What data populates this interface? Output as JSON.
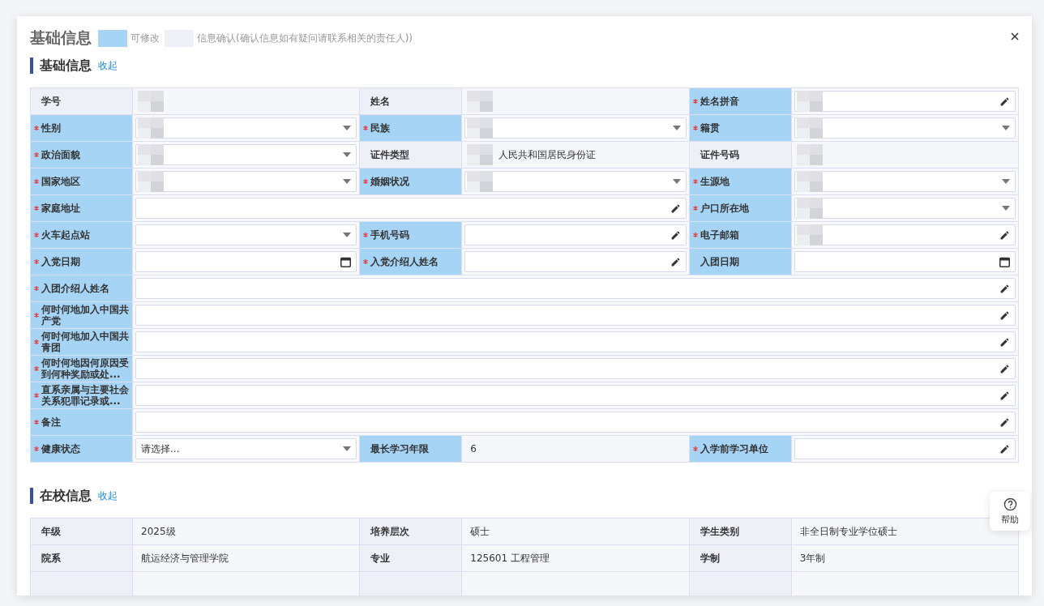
{
  "dialog": {
    "title": "基础信息",
    "legend": [
      {
        "kind": "editable",
        "label": "可修改"
      },
      {
        "kind": "confirm",
        "label": "信息确认(确认信息如有疑问请联系相关的责任人))"
      }
    ]
  },
  "sections": [
    {
      "title": "基础信息",
      "toggle": "收起",
      "fields": [
        {
          "label": "学号",
          "required": false,
          "editable": false,
          "kind": "readonly",
          "redacted": true
        },
        {
          "label": "姓名",
          "required": false,
          "editable": false,
          "kind": "readonly",
          "redacted": true
        },
        {
          "label": "姓名拼音",
          "required": true,
          "editable": true,
          "kind": "text",
          "redacted": true
        },
        {
          "label": "性别",
          "required": true,
          "editable": true,
          "kind": "select",
          "redacted": true
        },
        {
          "label": "民族",
          "required": true,
          "editable": true,
          "kind": "select",
          "redacted": true
        },
        {
          "label": "籍贯",
          "required": true,
          "editable": true,
          "kind": "select",
          "redacted": true
        },
        {
          "label": "政治面貌",
          "required": true,
          "editable": true,
          "kind": "select",
          "redacted": true
        },
        {
          "label": "证件类型",
          "required": false,
          "editable": false,
          "kind": "readonly",
          "value": "人民共和国居民身份证",
          "redacted": true
        },
        {
          "label": "证件号码",
          "required": false,
          "editable": false,
          "kind": "readonly",
          "redacted": true
        },
        {
          "label": "国家地区",
          "required": true,
          "editable": true,
          "kind": "select",
          "redacted": true
        },
        {
          "label": "婚姻状况",
          "required": true,
          "editable": true,
          "kind": "select",
          "redacted": true
        },
        {
          "label": "生源地",
          "required": true,
          "editable": true,
          "kind": "select",
          "redacted": true
        },
        {
          "label": "家庭地址",
          "required": true,
          "editable": true,
          "kind": "text",
          "wide": true
        },
        {
          "label": "户口所在地",
          "required": true,
          "editable": true,
          "kind": "select",
          "redacted": true
        },
        {
          "label": "火车起点站",
          "required": true,
          "editable": true,
          "kind": "select"
        },
        {
          "label": "手机号码",
          "required": true,
          "editable": true,
          "kind": "text"
        },
        {
          "label": "电子邮箱",
          "required": true,
          "editable": true,
          "kind": "text",
          "redacted": true
        },
        {
          "label": "入党日期",
          "required": true,
          "editable": true,
          "kind": "date"
        },
        {
          "label": "入党介绍人姓名",
          "required": true,
          "editable": true,
          "kind": "text"
        },
        {
          "label": "入团日期",
          "required": false,
          "editable": true,
          "kind": "date"
        },
        {
          "label": "入团介绍人姓名",
          "required": true,
          "editable": true,
          "kind": "text",
          "full": true
        },
        {
          "label": "何时何地加入中国共产党",
          "required": true,
          "editable": true,
          "kind": "text",
          "full": true
        },
        {
          "label": "何时何地加入中国共青团",
          "required": true,
          "editable": true,
          "kind": "text",
          "full": true
        },
        {
          "label": "何时何地因何原因受到何种奖励或处...",
          "required": true,
          "editable": true,
          "kind": "text",
          "full": true
        },
        {
          "label": "直系亲属与主要社会关系犯罪记录或...",
          "required": true,
          "editable": true,
          "kind": "text",
          "full": true
        },
        {
          "label": "备注",
          "required": true,
          "editable": true,
          "kind": "text",
          "full": true
        },
        {
          "label": "健康状态",
          "required": true,
          "editable": true,
          "kind": "select",
          "value": "请选择..."
        },
        {
          "label": "最长学习年限",
          "required": false,
          "editable": true,
          "kind": "readonly",
          "value": "6"
        },
        {
          "label": "入学前学习单位",
          "required": true,
          "editable": true,
          "kind": "text"
        }
      ]
    },
    {
      "title": "在校信息",
      "toggle": "收起",
      "fields": [
        {
          "label": "年级",
          "required": false,
          "editable": false,
          "kind": "readonly",
          "value": "2025级"
        },
        {
          "label": "培养层次",
          "required": false,
          "editable": false,
          "kind": "readonly",
          "value": "硕士"
        },
        {
          "label": "学生类别",
          "required": false,
          "editable": false,
          "kind": "readonly",
          "value": "非全日制专业学位硕士"
        },
        {
          "label": "院系",
          "required": false,
          "editable": false,
          "kind": "readonly",
          "value": "航运经济与管理学院"
        },
        {
          "label": "专业",
          "required": false,
          "editable": false,
          "kind": "readonly",
          "value": "125601 工程管理"
        },
        {
          "label": "学制",
          "required": false,
          "editable": false,
          "kind": "readonly",
          "value": "3年制"
        },
        {
          "kind": "readonly",
          "editable": false
        },
        {
          "kind": "readonly",
          "editable": false
        },
        {
          "kind": "readonly",
          "editable": false
        }
      ]
    }
  ],
  "help": {
    "label": "帮助"
  }
}
